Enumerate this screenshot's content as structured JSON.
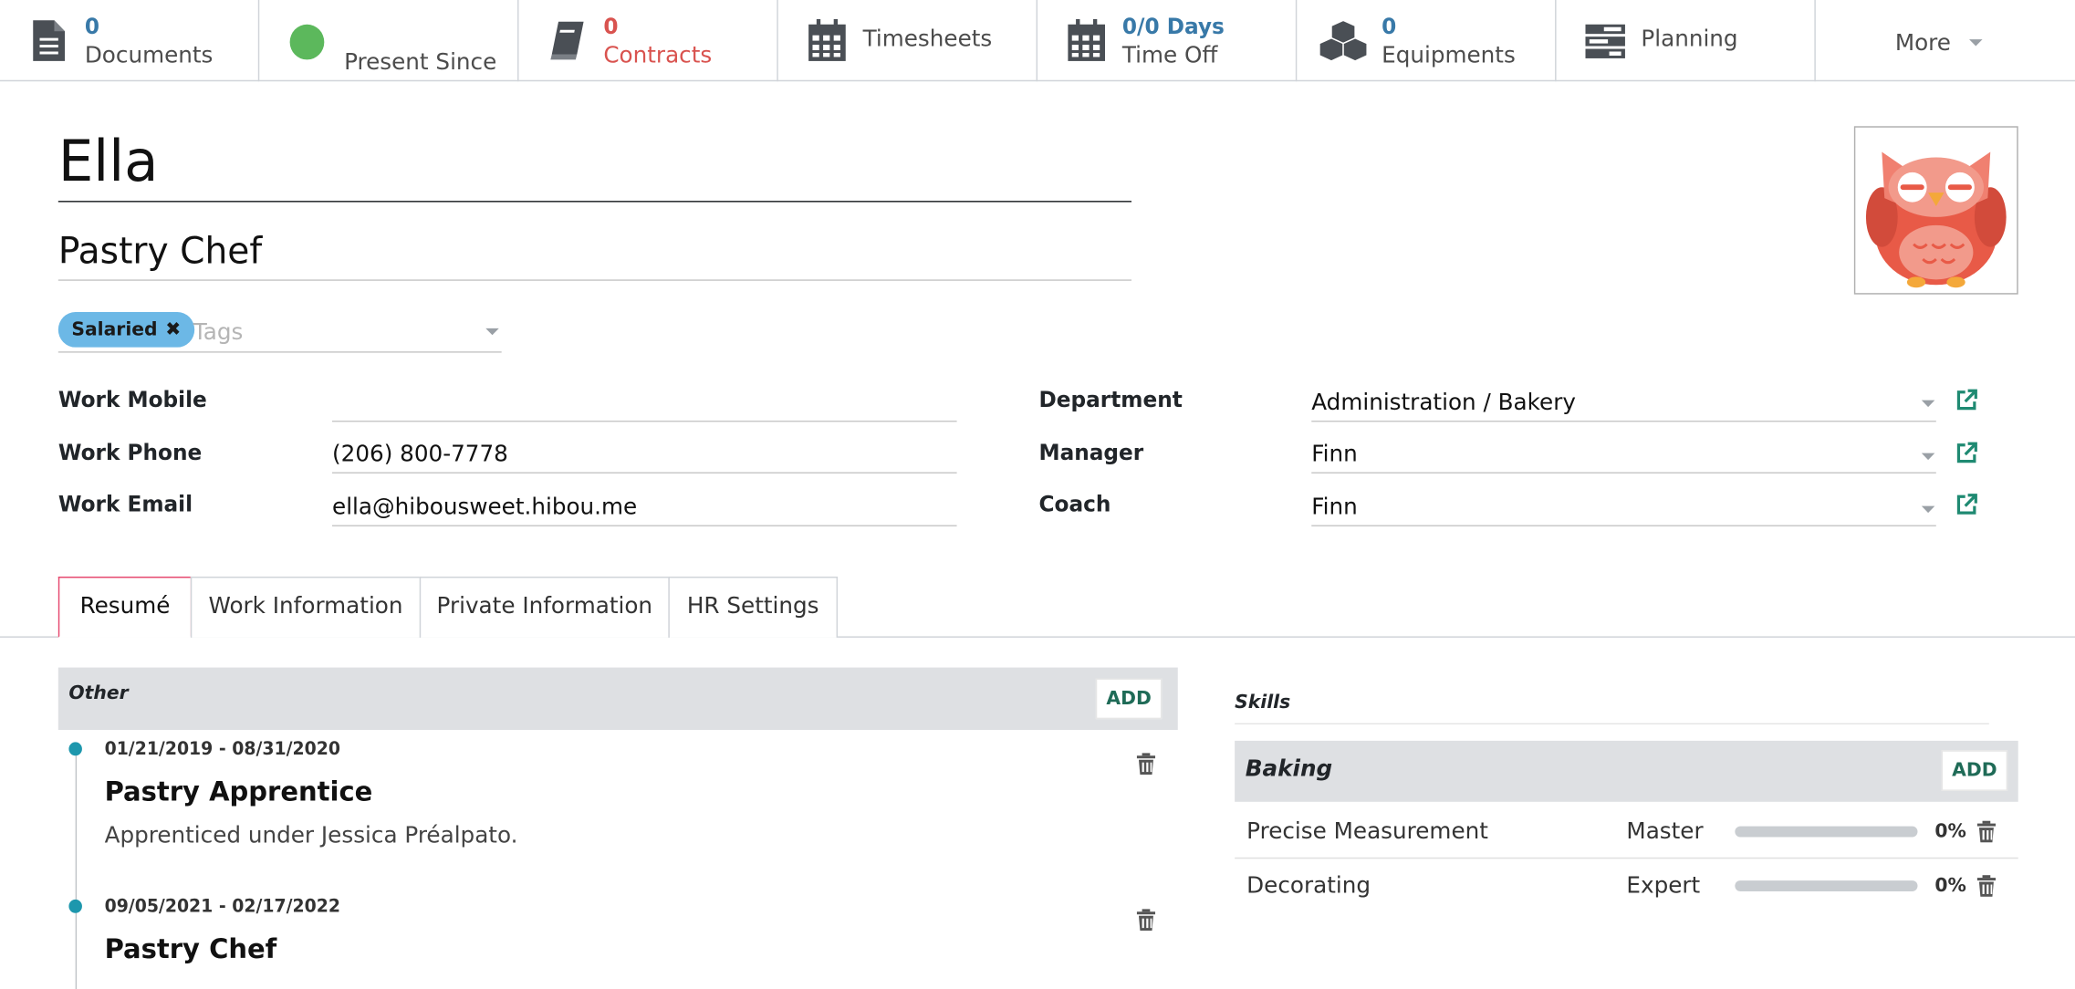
{
  "smart_buttons": [
    {
      "value": "0",
      "label": "Documents",
      "icon": "document-icon"
    },
    {
      "value": "",
      "label": "Present Since",
      "icon": "presence-dot-icon"
    },
    {
      "value": "0",
      "label": "Contracts",
      "icon": "book-icon"
    },
    {
      "value": "",
      "label": "Timesheets",
      "icon": "calendar-icon"
    },
    {
      "value": "0/0 Days",
      "label": "Time Off",
      "icon": "calendar-icon"
    },
    {
      "value": "0",
      "label": "Equipments",
      "icon": "cubes-icon"
    },
    {
      "value": "",
      "label": "Planning",
      "icon": "tasks-icon"
    },
    {
      "value": "",
      "label": "More",
      "icon": "caret-down-icon"
    }
  ],
  "colors": {
    "accent": "#1d97ad",
    "link_blue": "#3879a8",
    "danger": "#d9534f",
    "presence": "#5cb85c",
    "tab_active": "#e6486e",
    "button_text": "#1f6b57"
  },
  "employee": {
    "name": "Ella",
    "job_title": "Pastry Chef",
    "tags": [
      "Salaried"
    ],
    "tags_placeholder": "Tags"
  },
  "fields": {
    "work_mobile": {
      "label": "Work Mobile",
      "value": ""
    },
    "work_phone": {
      "label": "Work Phone",
      "value": "(206) 800-7778"
    },
    "work_email": {
      "label": "Work Email",
      "value": "ella@hibousweet.hibou.me"
    },
    "department": {
      "label": "Department",
      "value": "Administration / Bakery"
    },
    "manager": {
      "label": "Manager",
      "value": "Finn"
    },
    "coach": {
      "label": "Coach",
      "value": "Finn"
    }
  },
  "tabs": [
    {
      "label": "Resumé",
      "active": true
    },
    {
      "label": "Work Information",
      "active": false
    },
    {
      "label": "Private Information",
      "active": false
    },
    {
      "label": "HR Settings",
      "active": false
    }
  ],
  "resume": {
    "section_title": "Other",
    "add_label": "ADD",
    "lines": [
      {
        "dates": "01/21/2019 - 08/31/2020",
        "title": "Pastry Apprentice",
        "description": "Apprenticed under Jessica Préalpato."
      },
      {
        "dates": "09/05/2021 - 02/17/2022",
        "title": "Pastry Chef",
        "description": ""
      }
    ]
  },
  "skills": {
    "title": "Skills",
    "group": "Baking",
    "add_label": "ADD",
    "items": [
      {
        "name": "Precise Measurement",
        "level": "Master",
        "progress_text": "0%",
        "progress": 0
      },
      {
        "name": "Decorating",
        "level": "Expert",
        "progress_text": "0%",
        "progress": 0
      }
    ]
  }
}
